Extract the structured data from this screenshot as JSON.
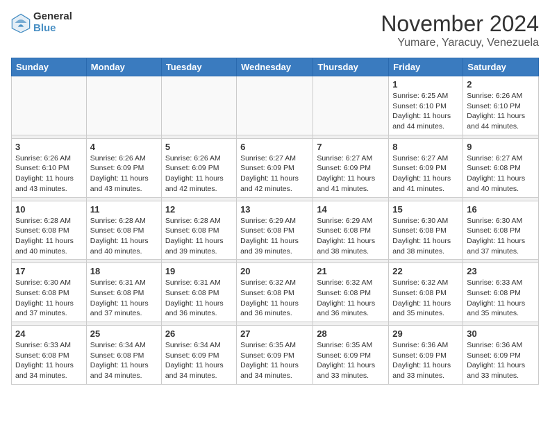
{
  "header": {
    "logo_general": "General",
    "logo_blue": "Blue",
    "month_title": "November 2024",
    "location": "Yumare, Yaracuy, Venezuela"
  },
  "weekdays": [
    "Sunday",
    "Monday",
    "Tuesday",
    "Wednesday",
    "Thursday",
    "Friday",
    "Saturday"
  ],
  "weeks": [
    [
      {
        "day": "",
        "info": ""
      },
      {
        "day": "",
        "info": ""
      },
      {
        "day": "",
        "info": ""
      },
      {
        "day": "",
        "info": ""
      },
      {
        "day": "",
        "info": ""
      },
      {
        "day": "1",
        "info": "Sunrise: 6:25 AM\nSunset: 6:10 PM\nDaylight: 11 hours and 44 minutes."
      },
      {
        "day": "2",
        "info": "Sunrise: 6:26 AM\nSunset: 6:10 PM\nDaylight: 11 hours and 44 minutes."
      }
    ],
    [
      {
        "day": "3",
        "info": "Sunrise: 6:26 AM\nSunset: 6:10 PM\nDaylight: 11 hours and 43 minutes."
      },
      {
        "day": "4",
        "info": "Sunrise: 6:26 AM\nSunset: 6:09 PM\nDaylight: 11 hours and 43 minutes."
      },
      {
        "day": "5",
        "info": "Sunrise: 6:26 AM\nSunset: 6:09 PM\nDaylight: 11 hours and 42 minutes."
      },
      {
        "day": "6",
        "info": "Sunrise: 6:27 AM\nSunset: 6:09 PM\nDaylight: 11 hours and 42 minutes."
      },
      {
        "day": "7",
        "info": "Sunrise: 6:27 AM\nSunset: 6:09 PM\nDaylight: 11 hours and 41 minutes."
      },
      {
        "day": "8",
        "info": "Sunrise: 6:27 AM\nSunset: 6:09 PM\nDaylight: 11 hours and 41 minutes."
      },
      {
        "day": "9",
        "info": "Sunrise: 6:27 AM\nSunset: 6:08 PM\nDaylight: 11 hours and 40 minutes."
      }
    ],
    [
      {
        "day": "10",
        "info": "Sunrise: 6:28 AM\nSunset: 6:08 PM\nDaylight: 11 hours and 40 minutes."
      },
      {
        "day": "11",
        "info": "Sunrise: 6:28 AM\nSunset: 6:08 PM\nDaylight: 11 hours and 40 minutes."
      },
      {
        "day": "12",
        "info": "Sunrise: 6:28 AM\nSunset: 6:08 PM\nDaylight: 11 hours and 39 minutes."
      },
      {
        "day": "13",
        "info": "Sunrise: 6:29 AM\nSunset: 6:08 PM\nDaylight: 11 hours and 39 minutes."
      },
      {
        "day": "14",
        "info": "Sunrise: 6:29 AM\nSunset: 6:08 PM\nDaylight: 11 hours and 38 minutes."
      },
      {
        "day": "15",
        "info": "Sunrise: 6:30 AM\nSunset: 6:08 PM\nDaylight: 11 hours and 38 minutes."
      },
      {
        "day": "16",
        "info": "Sunrise: 6:30 AM\nSunset: 6:08 PM\nDaylight: 11 hours and 37 minutes."
      }
    ],
    [
      {
        "day": "17",
        "info": "Sunrise: 6:30 AM\nSunset: 6:08 PM\nDaylight: 11 hours and 37 minutes."
      },
      {
        "day": "18",
        "info": "Sunrise: 6:31 AM\nSunset: 6:08 PM\nDaylight: 11 hours and 37 minutes."
      },
      {
        "day": "19",
        "info": "Sunrise: 6:31 AM\nSunset: 6:08 PM\nDaylight: 11 hours and 36 minutes."
      },
      {
        "day": "20",
        "info": "Sunrise: 6:32 AM\nSunset: 6:08 PM\nDaylight: 11 hours and 36 minutes."
      },
      {
        "day": "21",
        "info": "Sunrise: 6:32 AM\nSunset: 6:08 PM\nDaylight: 11 hours and 36 minutes."
      },
      {
        "day": "22",
        "info": "Sunrise: 6:32 AM\nSunset: 6:08 PM\nDaylight: 11 hours and 35 minutes."
      },
      {
        "day": "23",
        "info": "Sunrise: 6:33 AM\nSunset: 6:08 PM\nDaylight: 11 hours and 35 minutes."
      }
    ],
    [
      {
        "day": "24",
        "info": "Sunrise: 6:33 AM\nSunset: 6:08 PM\nDaylight: 11 hours and 34 minutes."
      },
      {
        "day": "25",
        "info": "Sunrise: 6:34 AM\nSunset: 6:08 PM\nDaylight: 11 hours and 34 minutes."
      },
      {
        "day": "26",
        "info": "Sunrise: 6:34 AM\nSunset: 6:09 PM\nDaylight: 11 hours and 34 minutes."
      },
      {
        "day": "27",
        "info": "Sunrise: 6:35 AM\nSunset: 6:09 PM\nDaylight: 11 hours and 34 minutes."
      },
      {
        "day": "28",
        "info": "Sunrise: 6:35 AM\nSunset: 6:09 PM\nDaylight: 11 hours and 33 minutes."
      },
      {
        "day": "29",
        "info": "Sunrise: 6:36 AM\nSunset: 6:09 PM\nDaylight: 11 hours and 33 minutes."
      },
      {
        "day": "30",
        "info": "Sunrise: 6:36 AM\nSunset: 6:09 PM\nDaylight: 11 hours and 33 minutes."
      }
    ]
  ]
}
